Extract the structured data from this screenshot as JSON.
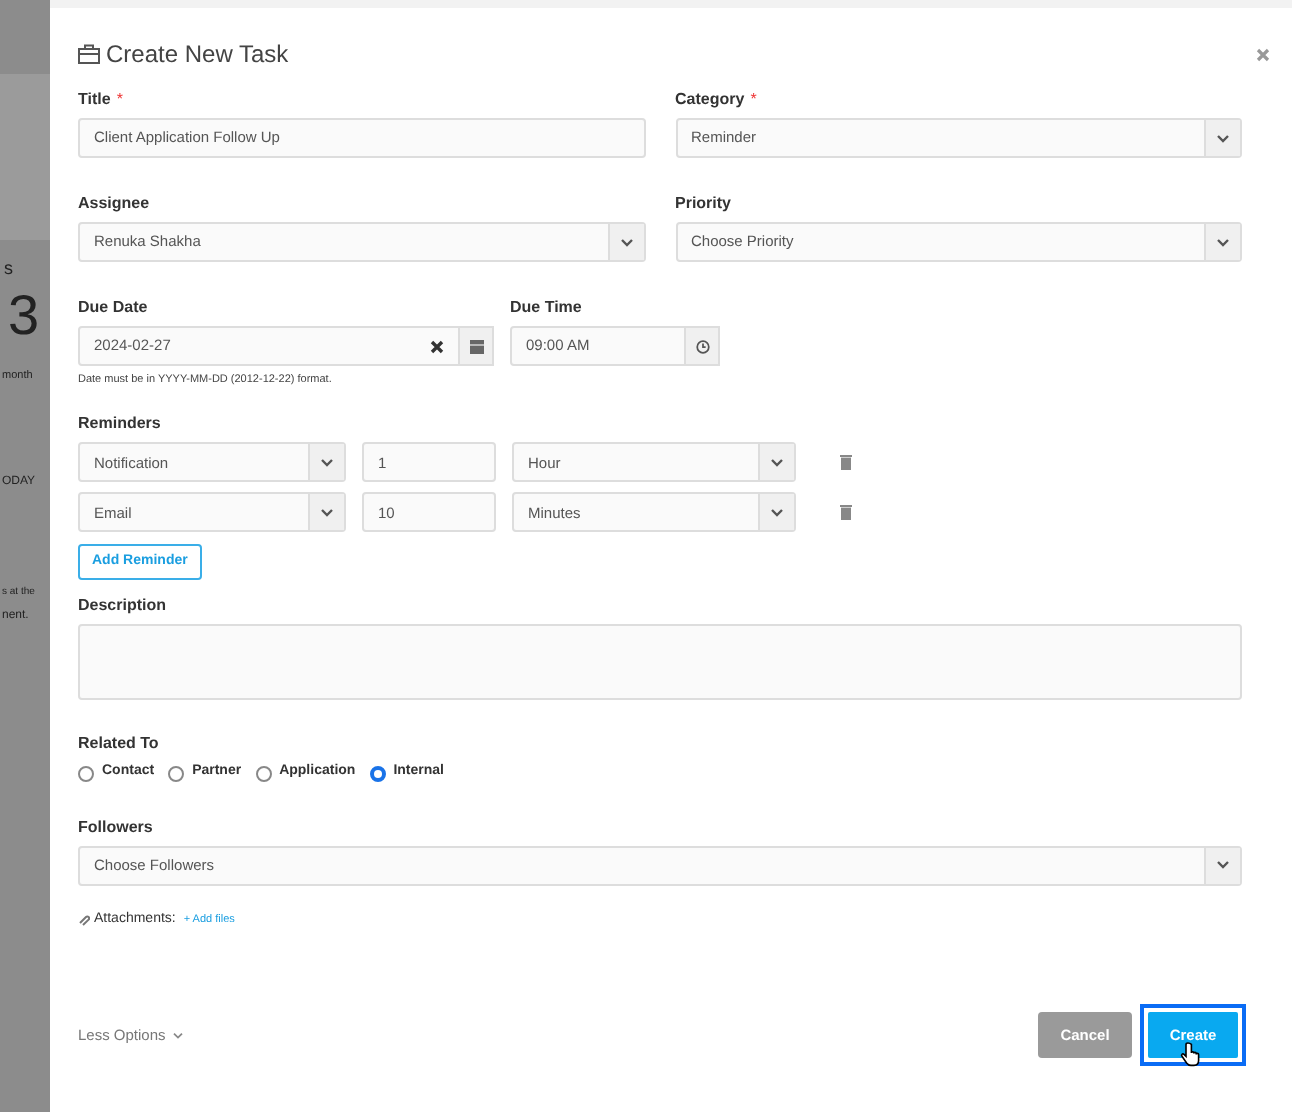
{
  "background": {
    "fragments": [
      "s",
      "3",
      "month",
      "ODAY",
      "s at the",
      "nent."
    ]
  },
  "dialog": {
    "title": "Create New Task",
    "title_field": {
      "label": "Title",
      "required_mark": "*",
      "value": "Client Application Follow Up"
    },
    "category": {
      "label": "Category",
      "required_mark": "*",
      "value": "Reminder"
    },
    "assignee": {
      "label": "Assignee",
      "value": "Renuka Shakha"
    },
    "priority": {
      "label": "Priority",
      "value": "Choose Priority"
    },
    "due_date": {
      "label": "Due Date",
      "value": "2024-02-27",
      "hint": "Date must be in YYYY-MM-DD (2012-12-22) format."
    },
    "due_time": {
      "label": "Due Time",
      "value": "09:00 AM"
    },
    "reminders": {
      "label": "Reminders",
      "items": [
        {
          "method": "Notification",
          "amount": "1",
          "unit": "Hour"
        },
        {
          "method": "Email",
          "amount": "10",
          "unit": "Minutes"
        }
      ],
      "add_button": "Add Reminder"
    },
    "description": {
      "label": "Description"
    },
    "related_to": {
      "label": "Related To",
      "options": [
        {
          "label": "Contact",
          "selected": false
        },
        {
          "label": "Partner",
          "selected": false
        },
        {
          "label": "Application",
          "selected": false
        },
        {
          "label": "Internal",
          "selected": true
        }
      ]
    },
    "followers": {
      "label": "Followers",
      "value": "Choose Followers"
    },
    "attachments": {
      "label": "Attachments:",
      "link": "+ Add files"
    },
    "footer": {
      "less_options": "Less Options",
      "cancel": "Cancel",
      "create": {
        "label": "Create",
        "focused": true
      }
    }
  }
}
